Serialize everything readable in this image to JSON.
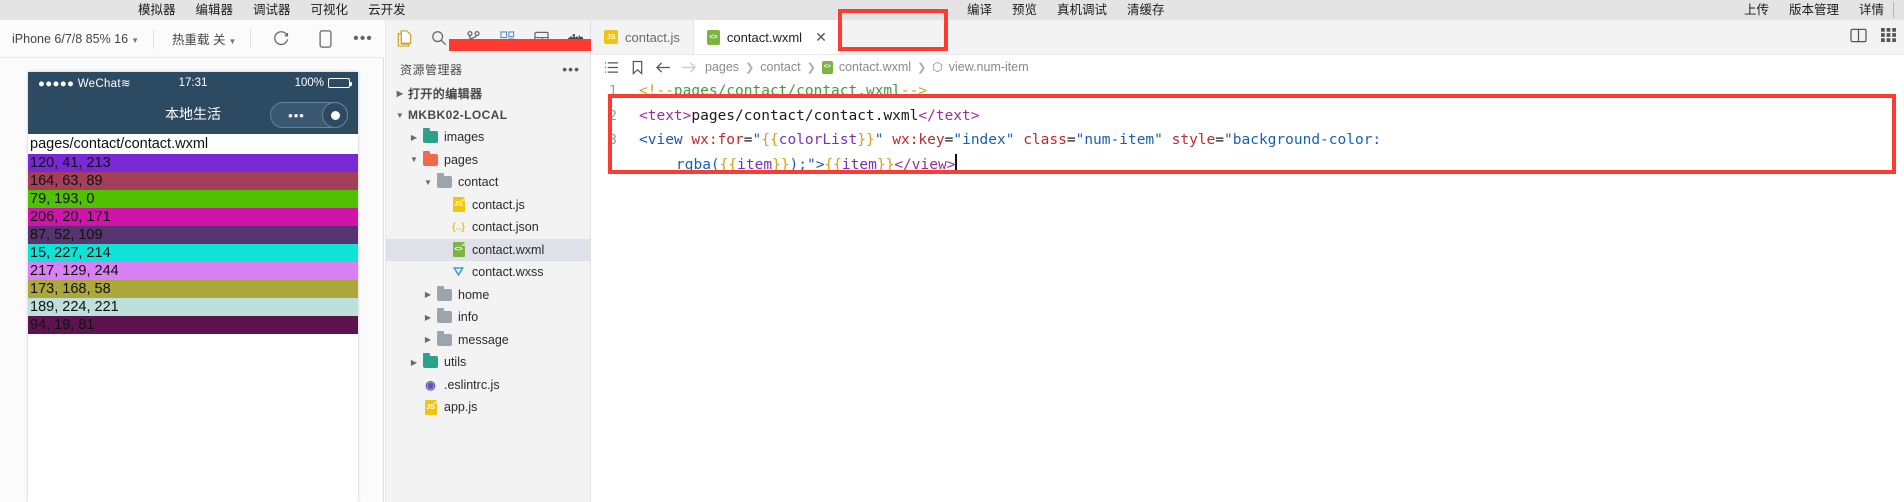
{
  "topbar": {
    "left_menu": [
      "模拟器",
      "编辑器",
      "调试器",
      "可视化",
      "云开发"
    ],
    "mid_menu": [
      "编译",
      "预览",
      "真机调试",
      "清缓存"
    ],
    "right_menu": [
      "上传",
      "版本管理",
      "详情"
    ]
  },
  "simulator": {
    "device_label": "iPhone 6/7/8 85% 16",
    "hotreload_label": "热重载 关",
    "refresh_icon": "refresh-icon",
    "device_icon": "device-icon",
    "more_icon": "more-icon",
    "phone": {
      "carrier": "●●●●● WeChat",
      "wifi_icon": "wifi-icon",
      "time": "17:31",
      "battery": "100%",
      "nav_title": "本地生活",
      "capsule_dots": "•••",
      "capsule_circle": "target-icon",
      "page_text": "pages/contact/contact.wxml",
      "color_items": [
        {
          "label": "120, 41, 213",
          "bg": "rgb(120,41,213)"
        },
        {
          "label": "164, 63, 89",
          "bg": "rgb(164,63,89)"
        },
        {
          "label": "79, 193, 0",
          "bg": "rgb(79,193,0)"
        },
        {
          "label": "206, 20, 171",
          "bg": "rgb(206,20,171)"
        },
        {
          "label": "87, 52, 109",
          "bg": "rgb(87,52,109)"
        },
        {
          "label": "15, 227, 214",
          "bg": "rgb(15,227,214)"
        },
        {
          "label": "217, 129, 244",
          "bg": "rgb(217,129,244)"
        },
        {
          "label": "173, 168, 58",
          "bg": "rgb(173,168,58)"
        },
        {
          "label": "189, 224, 221",
          "bg": "rgb(189,224,221)"
        },
        {
          "label": "94, 19, 81",
          "bg": "rgb(94,19,81)"
        }
      ]
    }
  },
  "explorer": {
    "icons": [
      "files-icon",
      "search-icon",
      "source-control-icon",
      "extensions-icon",
      "layout-icon",
      "docker-icon"
    ],
    "title": "资源管理器",
    "more_icon": "ellipsis-icon",
    "open_editors": "打开的编辑器",
    "project_root": "MKBK02-LOCAL",
    "tree": [
      {
        "label": "images",
        "type": "folder",
        "depth": 1,
        "expanded": false,
        "color": "#2aa18a"
      },
      {
        "label": "pages",
        "type": "folder",
        "depth": 1,
        "expanded": true,
        "color": "#f2694a"
      },
      {
        "label": "contact",
        "type": "folder",
        "depth": 2,
        "expanded": true,
        "color": "#9aa5ad"
      },
      {
        "label": "contact.js",
        "type": "js",
        "depth": 3,
        "color": "#f1c40f",
        "badge": "JS"
      },
      {
        "label": "contact.json",
        "type": "json",
        "depth": 3,
        "color": "#f1c40f",
        "badge": "{..}"
      },
      {
        "label": "contact.wxml",
        "type": "wxml",
        "depth": 3,
        "color": "#7cb342",
        "badge": "<>",
        "selected": true
      },
      {
        "label": "contact.wxss",
        "type": "wxss",
        "depth": 3,
        "color": "#3c9ee5",
        "badge": "3"
      },
      {
        "label": "home",
        "type": "folder",
        "depth": 2,
        "expanded": false,
        "color": "#9aa5ad"
      },
      {
        "label": "info",
        "type": "folder",
        "depth": 2,
        "expanded": false,
        "color": "#9aa5ad"
      },
      {
        "label": "message",
        "type": "folder",
        "depth": 2,
        "expanded": false,
        "color": "#9aa5ad"
      },
      {
        "label": "utils",
        "type": "folder",
        "depth": 1,
        "expanded": false,
        "color": "#2aa18a"
      },
      {
        "label": ".eslintrc.js",
        "type": "eslint",
        "depth": 1,
        "color": "#6a4fbb",
        "badge": "●"
      },
      {
        "label": "app.js",
        "type": "js",
        "depth": 1,
        "color": "#f1c40f",
        "badge": "JS"
      }
    ]
  },
  "editor": {
    "tabs": [
      {
        "label": "contact.js",
        "icon": "js-file-icon",
        "active": false
      },
      {
        "label": "contact.wxml",
        "icon": "wxml-file-icon",
        "active": true,
        "close_icon": "close-icon"
      }
    ],
    "split_icons": [
      "split-editor-icon",
      "layout-toggle-icon"
    ],
    "breadcrumb": {
      "outline_icon": "outline-icon",
      "bookmark-icon": "bookmark-icon",
      "back_icon": "back-arrow-icon",
      "forward_icon": "forward-arrow-icon",
      "parts": [
        "pages",
        "contact",
        "contact.wxml",
        "view.num-item"
      ]
    },
    "code": {
      "lines": [
        {
          "num": "1",
          "text": "<!--pages/contact/contact.wxml-->"
        },
        {
          "num": "2",
          "text": "<text>pages/contact/contact.wxml</text>"
        },
        {
          "num": "3",
          "text": "<view wx:for=\"{{colorList}}\" wx:key=\"index\" class=\"num-item\" style=\"background-color: rgba({{item}});\">{{item}}</view>"
        }
      ]
    }
  },
  "annotations": {
    "highlight_color": "#fe3b30"
  }
}
